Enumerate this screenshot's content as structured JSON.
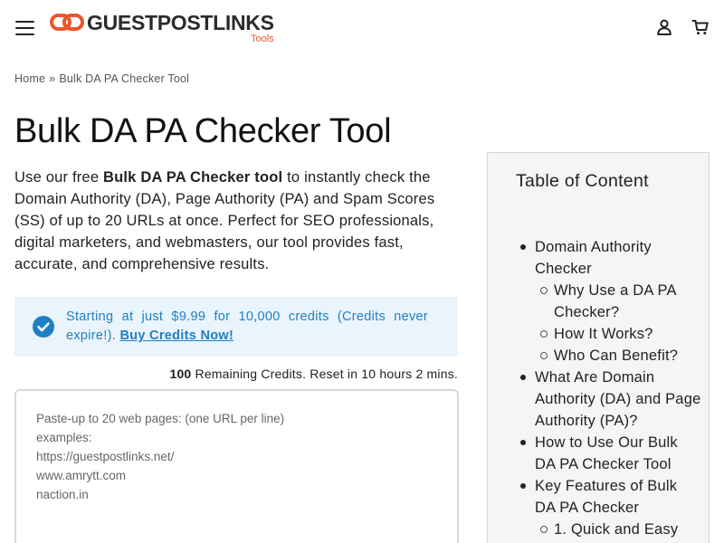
{
  "header": {
    "logo_text": "GUESTPOSTLINKS",
    "logo_sub": "Tools",
    "brand_color": "#e8572c",
    "menu_icon": "hamburger-menu-icon",
    "account_icon": "user-icon",
    "cart_icon": "cart-icon"
  },
  "breadcrumb": {
    "home": "Home",
    "separator": "»",
    "current": "Bulk DA PA Checker Tool"
  },
  "page": {
    "title": "Bulk DA PA Checker Tool",
    "intro_before": "Use our free ",
    "intro_bold": "Bulk DA PA Checker tool",
    "intro_after": " to instantly check the Domain Authority (DA), Page Authority (PA) and Spam Scores (SS) of up to 20 URLs at once. Perfect for SEO professionals, digital marketers, and webmasters, our tool provides fast, accurate, and comprehensive results."
  },
  "notice": {
    "text": "Starting at just $9.99 for 10,000 credits (Credits never expire!).",
    "link_label": "Buy Credits Now!",
    "accent_color": "#1e7fc4",
    "background": "#eaf4fc",
    "icon": "check-circle-icon"
  },
  "credits": {
    "count": "100",
    "text": "Remaining Credits. Reset in 10 hours 2 mins."
  },
  "url_input": {
    "placeholder": "Paste-up to 20 web pages: (one URL per line)\nexamples:\nhttps://guestpostlinks.net/\nwww.amrytt.com\nnaction.in",
    "value": ""
  },
  "toc": {
    "title": "Table of Content",
    "items": [
      {
        "label": "Domain Authority Checker",
        "level": 1
      },
      {
        "label": "Why Use a DA PA Checker?",
        "level": 2
      },
      {
        "label": "How It Works?",
        "level": 2
      },
      {
        "label": "Who Can Benefit?",
        "level": 2
      },
      {
        "label": "What Are Domain Authority (DA) and Page Authority (PA)?",
        "level": 1
      },
      {
        "label": "How to Use Our Bulk DA PA Checker Tool",
        "level": 1
      },
      {
        "label": "Key Features of Bulk DA PA Checker",
        "level": 1
      },
      {
        "label": "1. Quick and Easy",
        "level": 2
      }
    ]
  }
}
